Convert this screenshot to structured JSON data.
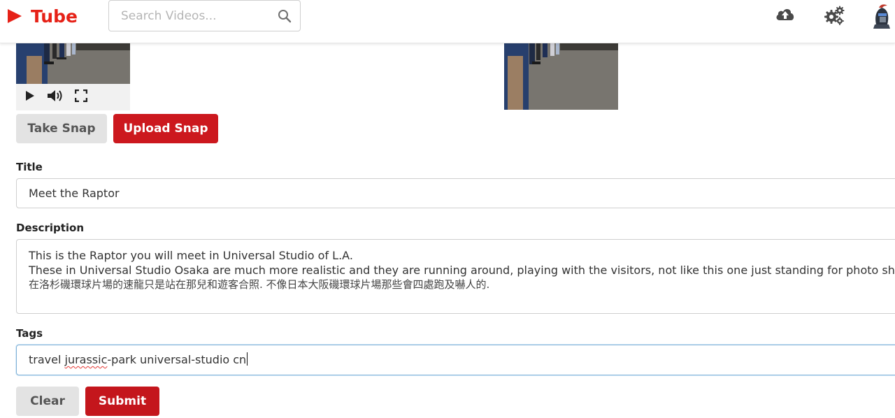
{
  "app": {
    "logo_text": "Tube",
    "brand_color": "#e62117"
  },
  "search": {
    "placeholder": "Search Videos...",
    "value": ""
  },
  "header_icons": [
    "cloud-upload-icon",
    "gears-icon",
    "avatar"
  ],
  "video": {
    "controls": [
      "play-icon",
      "volume-icon",
      "fullscreen-icon"
    ]
  },
  "snap_buttons": {
    "take": "Take Snap",
    "upload": "Upload Snap"
  },
  "form": {
    "title_label": "Title",
    "title_value": "Meet the Raptor",
    "description_label": "Description",
    "description_lines": [
      "This is the Raptor you will meet in Universal Studio of L.A.",
      "These in Universal Studio Osaka are much more realistic and they are running around, playing with the visitors, not like this one just standing for photo shooting.",
      "在洛杉磯環球片場的速龍只是站在那兒和遊客合照. 不像日本大阪磯環球片場那些會四處跑及嚇人的."
    ],
    "tags_label": "Tags",
    "tags_value": {
      "before": "travel ",
      "misspelled": "jurassic",
      "after": "-park universal-studio cn"
    },
    "clear_label": "Clear",
    "submit_label": "Submit"
  },
  "colors": {
    "primary_red": "#cc181e",
    "gray_button": "#e3e3e3",
    "focus_border": "#7fb0d6"
  }
}
